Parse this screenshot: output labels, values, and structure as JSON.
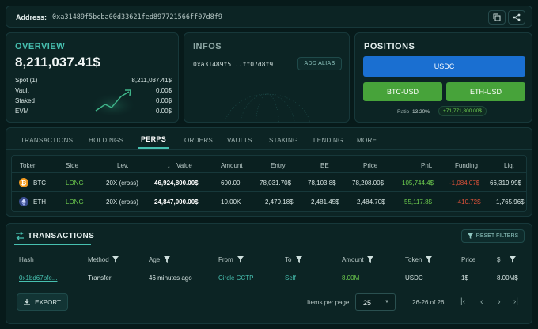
{
  "address_bar": {
    "label": "Address:",
    "value": "0xa31489f5bcba00d33621fed897721566ff07d8f9"
  },
  "overview": {
    "title": "OVERVIEW",
    "total": "8,211,037.41$",
    "rows": [
      {
        "label": "Spot (1)",
        "value": "8,211,037.41$"
      },
      {
        "label": "Vault",
        "value": "0.00$"
      },
      {
        "label": "Staked",
        "value": "0.00$"
      },
      {
        "label": "EVM",
        "value": "0.00$"
      }
    ]
  },
  "infos": {
    "title": "INFOS",
    "short_address": "0xa31489f5...ff07d8f9",
    "add_alias": "ADD ALIAS"
  },
  "positions": {
    "title": "POSITIONS",
    "usdc": "USDC",
    "btc_usd": "BTC-USD",
    "eth_usd": "ETH-USD",
    "ratio_label": "Ratio",
    "ratio_value": "13.20%",
    "pnl_badge": "+71,771,800.00$"
  },
  "tabs": [
    "TRANSACTIONS",
    "HOLDINGS",
    "PERPS",
    "ORDERS",
    "VAULTS",
    "STAKING",
    "LENDING",
    "MORE"
  ],
  "perps": {
    "headers": {
      "token": "Token",
      "side": "Side",
      "lev": "Lev.",
      "value": "Value",
      "amount": "Amount",
      "entry": "Entry",
      "be": "BE",
      "price": "Price",
      "pnl": "PnL",
      "funding": "Funding",
      "liq": "Liq."
    },
    "rows": [
      {
        "token": "BTC",
        "side": "LONG",
        "lev": "20X (cross)",
        "value": "46,924,800.00$",
        "amount": "600.00",
        "entry": "78,031.70$",
        "be": "78,103.8$",
        "price": "78,208.00$",
        "pnl": "105,744.4$",
        "funding": "-1,084.07$",
        "liq": "66,319.99$"
      },
      {
        "token": "ETH",
        "side": "LONG",
        "lev": "20X (cross)",
        "value": "24,847,000.00$",
        "amount": "10.00K",
        "entry": "2,479.18$",
        "be": "2,481.45$",
        "price": "2,484.70$",
        "pnl": "55,117.8$",
        "funding": "-410.72$",
        "liq": "1,765.96$"
      }
    ]
  },
  "transactions": {
    "title": "TRANSACTIONS",
    "reset_filters": "RESET FILTERS",
    "headers": {
      "hash": "Hash",
      "method": "Method",
      "age": "Age",
      "from": "From",
      "to": "To",
      "amount": "Amount",
      "token": "Token",
      "price": "Price",
      "usd": "$"
    },
    "rows": [
      {
        "hash": "0x1bd67bfe...",
        "method": "Transfer",
        "age": "46 minutes ago",
        "from": "Circle CCTP",
        "to": "Self",
        "amount": "8.00M",
        "token": "USDC",
        "price": "1$",
        "usd": "8.00M$"
      }
    ],
    "export": "EXPORT",
    "items_per_page_label": "Items per page:",
    "items_per_page_value": "25",
    "range": "26-26 of 26"
  },
  "colors": {
    "bg": "#071a1a",
    "panel": "#0c2424",
    "accent": "#47c0b0",
    "green": "#6fcf4f",
    "red": "#e0523a",
    "blue": "#1a6fd1"
  }
}
